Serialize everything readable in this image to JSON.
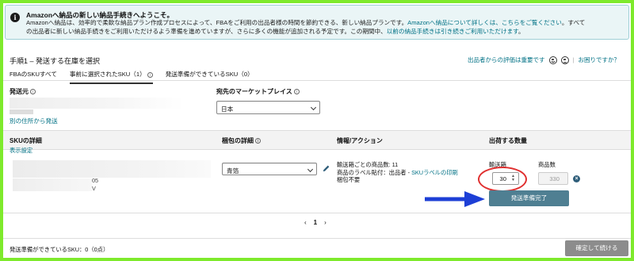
{
  "banner": {
    "title": "Amazonへ納品の新しい納品手続きへようこそ。",
    "line1_a": "Amazonへ納品は、効率的で柔軟な納品プラン作成プロセスによって、FBAをご利用の出品者様の時間を節約できる、新しい納品プランです。",
    "line1_link_a": "Amazonへ納品について詳しくは、",
    "line1_link_b": "こちらをご覧ください",
    "line1_b": "。すべて",
    "line2_a": "の出品者に新しい納品手続きをご利用いただけるよう準備を進めていますが、さらに多くの機能が追加される予定です。この期間中、",
    "line2_link": "以前の納品手続きは引き続きご利用いただけます",
    "line2_b": "。"
  },
  "header": {
    "step_title": "手順1 – 発送する在庫を選択",
    "feedback_label": "出品者からの評価は重要です",
    "help_link": "お困りですか？"
  },
  "tabs": [
    {
      "label": "FBAのSKUすべて"
    },
    {
      "label": "事前に選択されたSKU（1）"
    },
    {
      "label": "発送準備ができているSKU（0）"
    }
  ],
  "ship_from": {
    "label": "発送元",
    "link": "別の住所から発送"
  },
  "marketplace": {
    "label": "宛先のマーケットプレイス",
    "value": "日本"
  },
  "table": {
    "headers": {
      "sku": "SKUの詳細",
      "sku_sub": "表示設定",
      "packing": "梱包の詳細",
      "info": "情報/アクション",
      "qty": "出荷する数量"
    },
    "row": {
      "sku_frag1": "05",
      "sku_frag2": "V",
      "packing_value": "青箔",
      "info_line1": "輸送箱ごとの商品数: 11",
      "info_line2_a": "商品のラベル貼付：出品者 -",
      "info_line2_link": "SKUラベルの印刷",
      "info_line3": "梱包不要",
      "boxes_label": "輸送箱",
      "units_label": "商品数",
      "boxes_value": "30",
      "units_value": "330",
      "ready_button": "発送準備完了"
    }
  },
  "pager": {
    "prev": "‹",
    "page": "1",
    "next": "›"
  },
  "footer": {
    "status": "発送準備ができているSKU：0（0点）",
    "confirm_button": "確定して続ける"
  },
  "colors": {
    "frame_border": "#7eea2c",
    "banner_bg": "#eaf5f6",
    "link": "#007185",
    "ready_button": "#4f7f92",
    "annotation_red": "#e03030",
    "annotation_blue": "#1d3fd6"
  }
}
